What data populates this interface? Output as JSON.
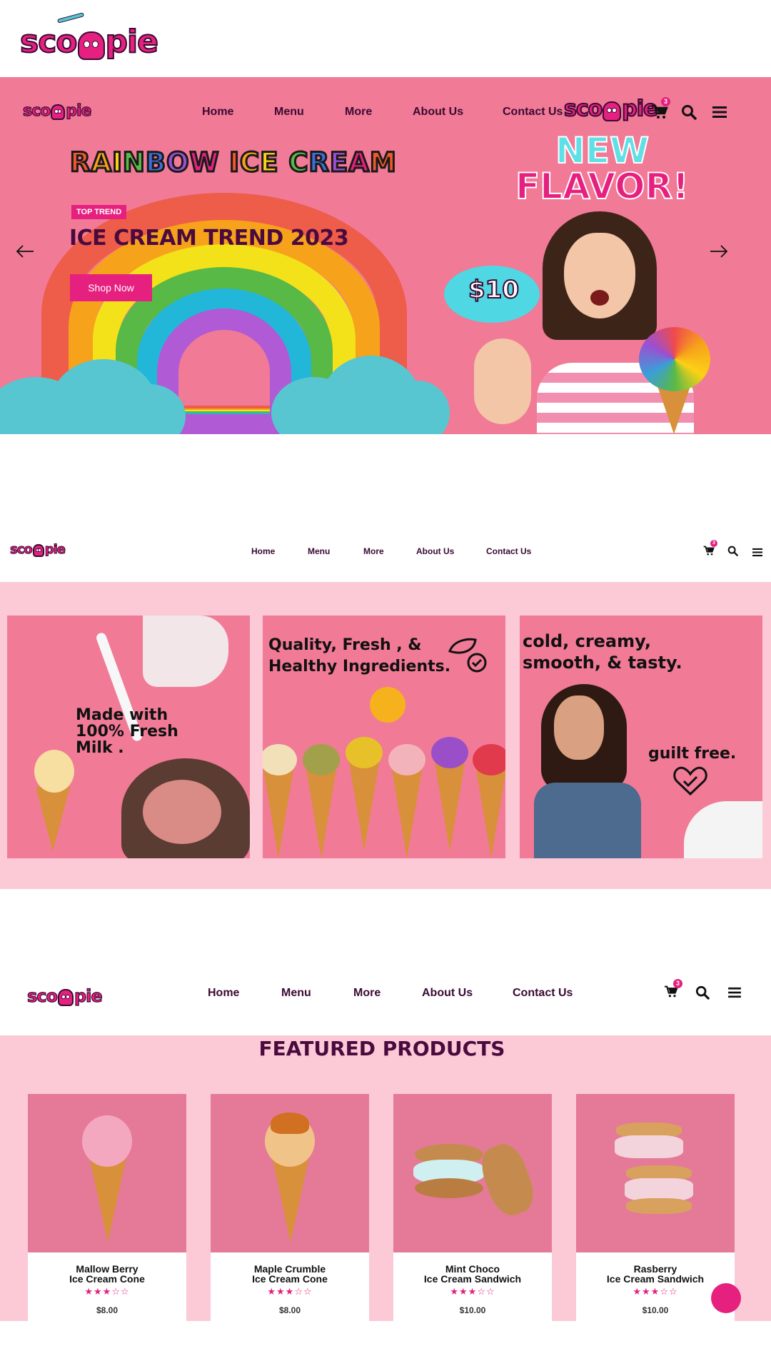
{
  "brand": {
    "logo_text_left": "sco",
    "logo_text_right": "pie"
  },
  "nav": {
    "items": [
      "Home",
      "Menu",
      "More",
      "About Us",
      "Contact Us"
    ],
    "cart_count": "3"
  },
  "hero": {
    "headline_letters": [
      "R",
      "A",
      "I",
      "N",
      "B",
      "O",
      "W",
      " ",
      "I",
      "C",
      "E",
      " ",
      "C",
      "R",
      "E",
      "A",
      "M"
    ],
    "headline_colors": [
      "#f0592b",
      "#f7a21b",
      "#fcd116",
      "#58b947",
      "#3b6fd8",
      "#9b4fd2",
      "#e6207f",
      "",
      "#f0592b",
      "#f7a21b",
      "#fcd116",
      "",
      "#58b947",
      "#3b6fd8",
      "#9b4fd2",
      "#e6207f",
      "#f0592b"
    ],
    "tag": "TOP TREND",
    "title": "ICE CREAM TREND 2023",
    "cta": "Shop Now",
    "new_label": "NEW",
    "flavor_label": "FLAVOR!",
    "price_bubble": "$10",
    "prev_arrow": "arrow-left-icon",
    "next_arrow": "arrow-right-icon"
  },
  "banners": [
    {
      "text": "Made with 100% Fresh Milk ."
    },
    {
      "text_line1": "Quality, Fresh , &",
      "text_line2": "Healthy Ingredients."
    },
    {
      "text_line1": "cold, creamy,",
      "text_line2": "smooth, & tasty.",
      "text_line3": "guilt free."
    }
  ],
  "products_section": {
    "title": "FEATURED PRODUCTS",
    "products": [
      {
        "name_line1": "Mallow Berry",
        "name_line2": "Ice Cream Cone",
        "rating": 3,
        "stars": "★★★☆☆",
        "price": "$8.00"
      },
      {
        "name_line1": "Maple Crumble",
        "name_line2": "Ice Cream Cone",
        "rating": 3,
        "stars": "★★★☆☆",
        "price": "$8.00"
      },
      {
        "name_line1": "Mint Choco",
        "name_line2": "Ice Cream Sandwich",
        "rating": 3,
        "stars": "★★★☆☆",
        "price": "$10.00"
      },
      {
        "name_line1": "Rasberry",
        "name_line2": "Ice Cream Sandwich",
        "rating": 3,
        "stars": "★★★☆☆",
        "price": "$10.00"
      }
    ]
  },
  "colors": {
    "brand_pink": "#e6207f",
    "hero_bg": "#f17a96",
    "section_bg": "#fccad6",
    "dark_text": "#3a0a33",
    "cloud_teal": "#57c6d0"
  }
}
